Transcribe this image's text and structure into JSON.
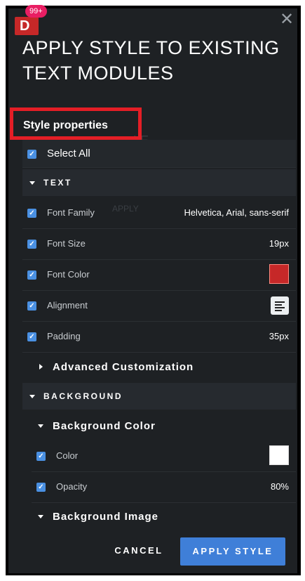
{
  "header": {
    "logo_letter": "D",
    "badge": "99+",
    "close_glyph": "✕",
    "title": "APPLY STYLE TO EXISTING TEXT MODULES"
  },
  "section_title": "Style properties",
  "select_all": "Select All",
  "groups": {
    "text": "TEXT",
    "background": "BACKGROUND"
  },
  "text_rows": [
    {
      "label": "Font Family",
      "value": "Helvetica, Arial, sans-serif"
    },
    {
      "label": "Font Size",
      "value": "19px"
    },
    {
      "label": "Font Color",
      "swatch": "#c62828"
    },
    {
      "label": "Alignment",
      "icon": "align-left-icon"
    },
    {
      "label": "Padding",
      "value": "35px"
    }
  ],
  "subsections": {
    "advanced": "Advanced Customization",
    "bg_color": "Background Color",
    "bg_image": "Background Image"
  },
  "bg_rows": [
    {
      "label": "Color",
      "swatch": "#ffffff"
    },
    {
      "label": "Opacity",
      "value": "80%"
    }
  ],
  "buttons": {
    "cancel": "CANCEL",
    "apply": "APPLY STYLE"
  },
  "colors": {
    "accent": "#3f7fd8",
    "highlight": "#e41e26",
    "panel": "#1e2124"
  }
}
